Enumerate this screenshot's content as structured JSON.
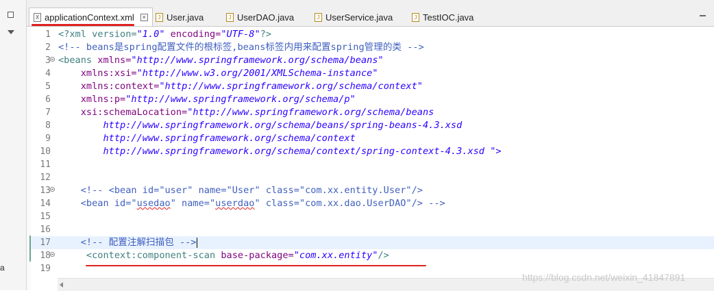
{
  "tabs": [
    {
      "label": "applicationContext.xml",
      "icon": "xml-file-icon",
      "active": true
    },
    {
      "label": "User.java",
      "icon": "java-file-icon"
    },
    {
      "label": "UserDAO.java",
      "icon": "java-file-icon"
    },
    {
      "label": "UserService.java",
      "icon": "java-file-icon"
    },
    {
      "label": "TestIOC.java",
      "icon": "java-file-icon"
    }
  ],
  "left_strip_letter": "a",
  "code_lines": [
    {
      "num": "1"
    },
    {
      "num": "2"
    },
    {
      "num": "3"
    },
    {
      "num": "4"
    },
    {
      "num": "5"
    },
    {
      "num": "6"
    },
    {
      "num": "7"
    },
    {
      "num": "8"
    },
    {
      "num": "9"
    },
    {
      "num": "10"
    },
    {
      "num": "11"
    },
    {
      "num": "12"
    },
    {
      "num": "13"
    },
    {
      "num": "14"
    },
    {
      "num": "15"
    },
    {
      "num": "16"
    },
    {
      "num": "17"
    },
    {
      "num": "18"
    },
    {
      "num": "19"
    }
  ],
  "code": {
    "l1_a": "<?xml version=",
    "l1_b": "\"1.0\"",
    "l1_c": " encoding=",
    "l1_d": "\"UTF-8\"",
    "l1_e": "?>",
    "l2": "<!-- beans是spring配置文件的根标签,beans标签内用来配置spring管理的类 -->",
    "l3_a": "<beans",
    "l3_b": " xmlns=",
    "l3_c": "\"http://www.springframework.org/schema/beans\"",
    "l4_a": "    xmlns:xsi=",
    "l4_b": "\"http://www.w3.org/2001/XMLSchema-instance\"",
    "l5_a": "    xmlns:context=",
    "l5_b": "\"http://www.springframework.org/schema/context\"",
    "l6_a": "    xmlns:p=",
    "l6_b": "\"http://www.springframework.org/schema/p\"",
    "l7_a": "    xsi:schemaLocation=",
    "l7_b": "\"http://www.springframework.org/schema/beans",
    "l8": "        http://www.springframework.org/schema/beans/spring-beans-4.3.xsd",
    "l9": "        http://www.springframework.org/schema/context",
    "l10_a": "        http://www.springframework.org/schema/context/spring-context-4.3.xsd ",
    "l10_b": "\">",
    "l13": "    <!-- <bean id=\"user\" name=\"User\" class=\"com.xx.entity.User\"/>",
    "l14_a": "    <bean id=\"",
    "l14_b": "usedao",
    "l14_c": "\" name=\"",
    "l14_d": "userdao",
    "l14_e": "\" class=\"com.xx.dao.UserDAO\"/> -->",
    "l17": "    <!-- 配置注解扫描包 -->",
    "l18_a": "     <context:component-scan",
    "l18_b": " base-package=",
    "l18_c": "\"com.xx.entity\"",
    "l18_d": "/>"
  },
  "watermark": "https://blog.csdn.net/weixin_41847891",
  "colors": {
    "tag": "#3f7f7f",
    "attribute": "#7f007f",
    "string": "#2a00ff",
    "comment": "#3f5fbf",
    "current_line": "#e8f2fe",
    "annotation_underline": "#e02020"
  }
}
